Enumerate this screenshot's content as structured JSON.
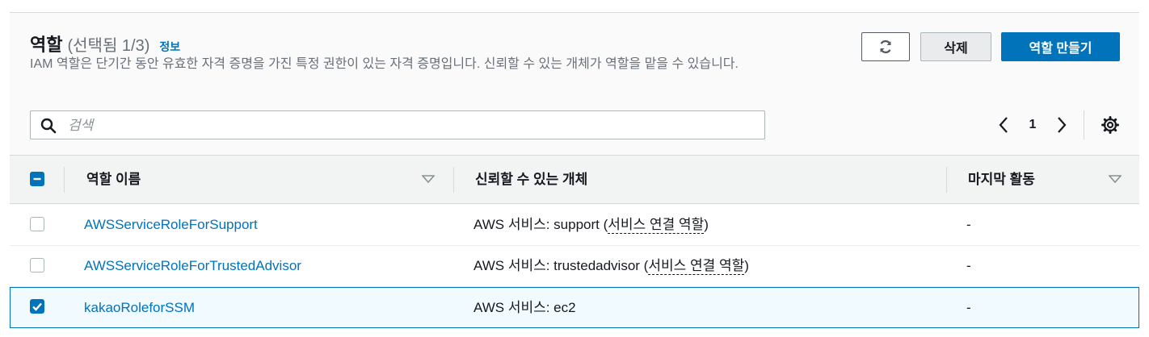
{
  "header": {
    "title": "역할",
    "count": "(선택됨 1/3)",
    "info": "정보",
    "description": "IAM 역할은 단기간 동안 유효한 자격 증명을 가진 특정 권한이 있는 자격 증명입니다. 신뢰할 수 있는 개체가 역할을 맡을 수 있습니다."
  },
  "actions": {
    "refresh_icon": "refresh-icon",
    "delete_label": "삭제",
    "create_label": "역할 만들기"
  },
  "search": {
    "placeholder": "검색",
    "value": ""
  },
  "pagination": {
    "current_page": "1"
  },
  "table": {
    "columns": [
      "역할 이름",
      "신뢰할 수 있는 개체",
      "마지막 활동"
    ],
    "rows": [
      {
        "selected": false,
        "name": "AWSServiceRoleForSupport",
        "trusted_prefix": "AWS 서비스: support (",
        "trusted_link": "서비스 연결 역할",
        "trusted_suffix": ")",
        "last_activity": "-"
      },
      {
        "selected": false,
        "name": "AWSServiceRoleForTrustedAdvisor",
        "trusted_prefix": "AWS 서비스: trustedadvisor (",
        "trusted_link": "서비스 연결 역할",
        "trusted_suffix": ")",
        "last_activity": "-"
      },
      {
        "selected": true,
        "name": "kakaoRoleforSSM",
        "trusted_prefix": "AWS 서비스: ec2",
        "trusted_link": "",
        "trusted_suffix": "",
        "last_activity": "-"
      }
    ]
  },
  "colors": {
    "accent": "#0073bb",
    "selected_row_bg": "#f1faff",
    "header_bg": "#fafafa"
  }
}
